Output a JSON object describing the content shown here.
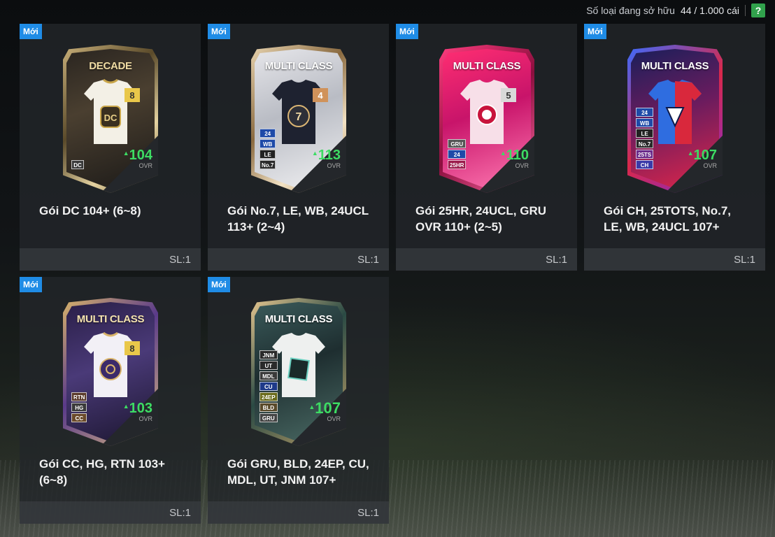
{
  "header": {
    "label": "Số loại đang sở hữu",
    "count": "44 / 1.000 cái",
    "help": "?"
  },
  "colors": {
    "new_badge": "#1f8ce6",
    "ovr_green": "#3ddc63",
    "help_green": "#31a24c"
  },
  "packs": [
    {
      "badge": "Mới",
      "card_label": "DECADE",
      "jersey_number": "8",
      "ovr": "104",
      "ovr_label": "OVR",
      "chips": [
        "DC"
      ],
      "title": "Gói DC 104+ (6~8)",
      "qty": "SL:1"
    },
    {
      "badge": "Mới",
      "card_label": "MULTI CLASS",
      "jersey_number": "4",
      "ovr": "113",
      "ovr_label": "OVR",
      "chips": [
        "24",
        "WB",
        "LE",
        "No.7"
      ],
      "title": "Gói No.7, LE, WB, 24UCL 113+ (2~4)",
      "qty": "SL:1"
    },
    {
      "badge": "Mới",
      "card_label": "MULTI CLASS",
      "jersey_number": "5",
      "ovr": "110",
      "ovr_label": "OVR",
      "chips": [
        "GRU",
        "24",
        "25HR"
      ],
      "title": "Gói 25HR, 24UCL, GRU OVR 110+ (2~5)",
      "qty": "SL:1"
    },
    {
      "badge": "Mới",
      "card_label": "MULTI CLASS",
      "jersey_number": "",
      "ovr": "107",
      "ovr_label": "OVR",
      "chips": [
        "24",
        "WB",
        "LE",
        "No.7",
        "25TS",
        "CH"
      ],
      "title": "Gói CH, 25TOTS, No.7, LE, WB, 24UCL 107+",
      "qty": "SL:1"
    },
    {
      "badge": "Mới",
      "card_label": "MULTI CLASS",
      "jersey_number": "8",
      "ovr": "103",
      "ovr_label": "OVR",
      "chips": [
        "RTN",
        "HG",
        "CC"
      ],
      "title": "Gói CC, HG, RTN 103+ (6~8)",
      "qty": "SL:1"
    },
    {
      "badge": "Mới",
      "card_label": "MULTI CLASS",
      "jersey_number": "",
      "ovr": "107",
      "ovr_label": "OVR",
      "chips": [
        "JNM",
        "UT",
        "MDL",
        "CU",
        "24EP",
        "BLD",
        "GRU"
      ],
      "title": "Gói GRU, BLD, 24EP, CU, MDL, UT, JNM 107+",
      "qty": "SL:1"
    }
  ]
}
